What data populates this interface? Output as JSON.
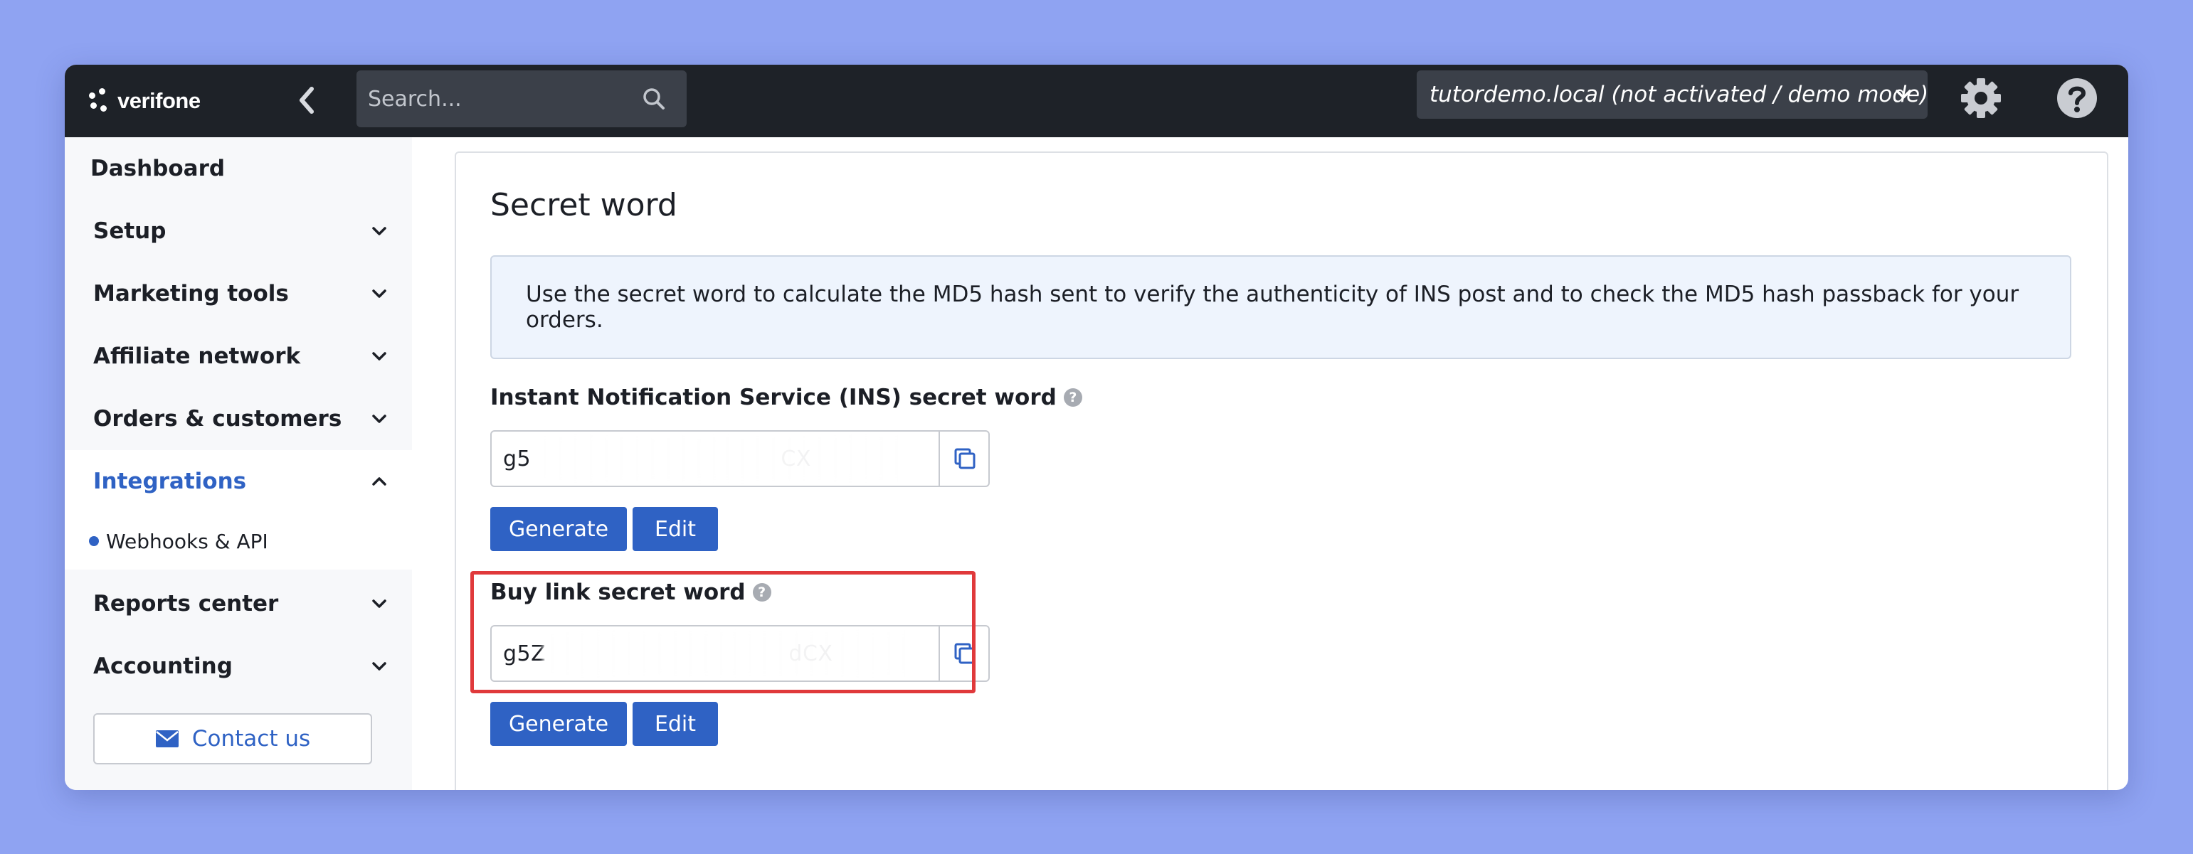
{
  "brand": {
    "name": "verifone"
  },
  "topbar": {
    "search": {
      "placeholder": "Search...",
      "value": ""
    },
    "site_selector": {
      "label": "tutordemo.local (not activated / demo mode)"
    }
  },
  "sidebar": {
    "items": [
      {
        "label": "Dashboard",
        "has_chevron": false
      },
      {
        "label": "Setup",
        "has_chevron": true
      },
      {
        "label": "Marketing tools",
        "has_chevron": true
      },
      {
        "label": "Affiliate network",
        "has_chevron": true
      },
      {
        "label": "Orders & customers",
        "has_chevron": true
      },
      {
        "label": "Integrations",
        "has_chevron": true,
        "expanded": true,
        "active": true
      },
      {
        "label": "Reports center",
        "has_chevron": true
      },
      {
        "label": "Accounting",
        "has_chevron": true
      }
    ],
    "sub_items": [
      {
        "label": "Webhooks & API",
        "parent": "Integrations"
      }
    ],
    "contact_label": "Contact us"
  },
  "main": {
    "title": "Secret word",
    "info_text": "Use the secret word to calculate the MD5 hash sent to verify the authenticity of INS post and to check the MD5 hash passback for your orders.",
    "ins": {
      "label": "Instant Notification Service (INS) secret word",
      "value": "g5                                   CX",
      "generate_label": "Generate",
      "edit_label": "Edit"
    },
    "buylink": {
      "label": "Buy link secret word",
      "value": "g5Z                                  dCX",
      "generate_label": "Generate",
      "edit_label": "Edit"
    }
  },
  "colors": {
    "background": "#8fa3f2",
    "topbar": "#1e2228",
    "accent": "#2f62c4",
    "info_box": "#eef4fd",
    "highlight": "#e0393b"
  }
}
